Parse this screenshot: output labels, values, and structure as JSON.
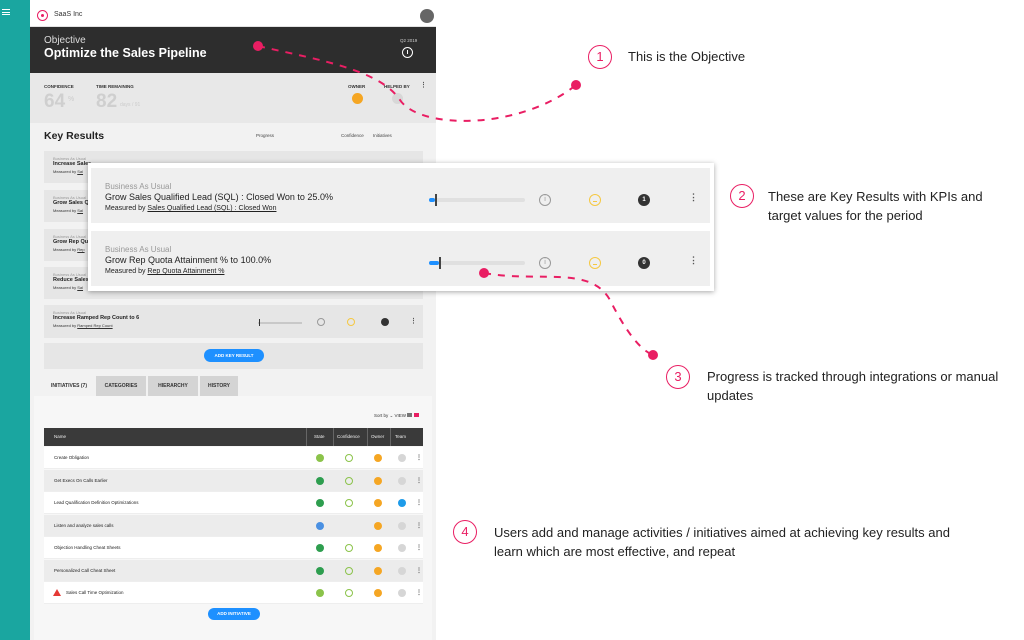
{
  "app": {
    "company": "SaaS Inc"
  },
  "objective": {
    "label": "Objective",
    "title": "Optimize the Sales Pipeline",
    "quarter": "Q2 2019"
  },
  "metrics": {
    "confidence_label": "CONFIDENCE",
    "confidence_value": "64",
    "confidence_unit": "%",
    "time_label": "TIME REMAINING",
    "time_value": "82",
    "time_unit": "days / 91",
    "owner_label": "OWNER",
    "helped_label": "HELPED BY"
  },
  "key_results": {
    "heading": "Key Results",
    "progress_label": "Progress",
    "confidence_label": "Confidence",
    "initiatives_label": "Initiatives",
    "add_label": "ADD KEY RESULT",
    "rows": [
      {
        "category": "Business As Usual",
        "title": "Increase Sales",
        "measured": "Measured by",
        "link": "Sal"
      },
      {
        "category": "Business As Usual",
        "title": "Grow Sales Qu",
        "measured": "Measured by",
        "link": "Sal"
      },
      {
        "category": "Business As Usual",
        "title": "Grow Rep Qu",
        "measured": "Measured by",
        "link": "Rep"
      },
      {
        "category": "Business As Usual",
        "title": "Reduce Sales",
        "measured": "Measured by",
        "link": "Sal"
      },
      {
        "category": "Business As Usual",
        "title": "Increase Ramped Rep Count to 6",
        "measured": "Measured by",
        "link": "Ramped Rep Count"
      }
    ]
  },
  "zoom": {
    "rows": [
      {
        "category": "Business As Usual",
        "title": "Grow Sales Qualified Lead (SQL) : Closed Won to 25.0%",
        "measured": "Measured by",
        "link": "Sales Qualified Lead (SQL) : Closed Won",
        "progress": 0.06,
        "initiatives": "1"
      },
      {
        "category": "Business As Usual",
        "title": "Grow Rep Quota Attainment % to 100.0%",
        "measured": "Measured by",
        "link": "Rep Quota Attainment %",
        "progress": 0.1,
        "initiatives": "0"
      }
    ]
  },
  "tabs": {
    "items": [
      "INITIATIVES (7)",
      "CATEGORIES",
      "HIERARCHY",
      "HISTORY"
    ]
  },
  "initiatives": {
    "sort_label": "Sort by",
    "view_label": "VIEW",
    "columns": [
      "Name",
      "State",
      "Confidence",
      "Owner",
      "Team"
    ],
    "rows": [
      {
        "name": "Create Obligation",
        "state": "#8bc34a",
        "team": "#d6d6d6"
      },
      {
        "name": "Get Execs On Calls Earlier",
        "state": "#2e9e4f",
        "team": "#d6d6d6"
      },
      {
        "name": "Lead Qualification Definition Optimizations",
        "state": "#2e9e4f",
        "team": "#1e9be9"
      },
      {
        "name": "Listen and analyze sales calls",
        "state": "#4a90e2",
        "team": "#d6d6d6"
      },
      {
        "name": "Objection Handling Cheat Sheets",
        "state": "#2e9e4f",
        "team": "#d6d6d6"
      },
      {
        "name": "Personalized Call Cheat Sheet",
        "state": "#2e9e4f",
        "team": "#d6d6d6"
      },
      {
        "name": "Sales Call Time Optimization",
        "state": "#8bc34a",
        "team": "#d6d6d6"
      }
    ],
    "add_label": "ADD INITIATIVE"
  },
  "annotations": [
    {
      "number": "1",
      "text": "This is the Objective"
    },
    {
      "number": "2",
      "text": "These are Key Results with KPIs and target values for the period"
    },
    {
      "number": "3",
      "text": "Progress is tracked through integrations or manual updates"
    },
    {
      "number": "4",
      "text": "Users add and manage activities / initiatives aimed at achieving key results and learn which are most effective, and repeat"
    }
  ],
  "colors": {
    "accent": "#e91e63",
    "teal": "#1aa6a0",
    "primary": "#1e90ff"
  }
}
